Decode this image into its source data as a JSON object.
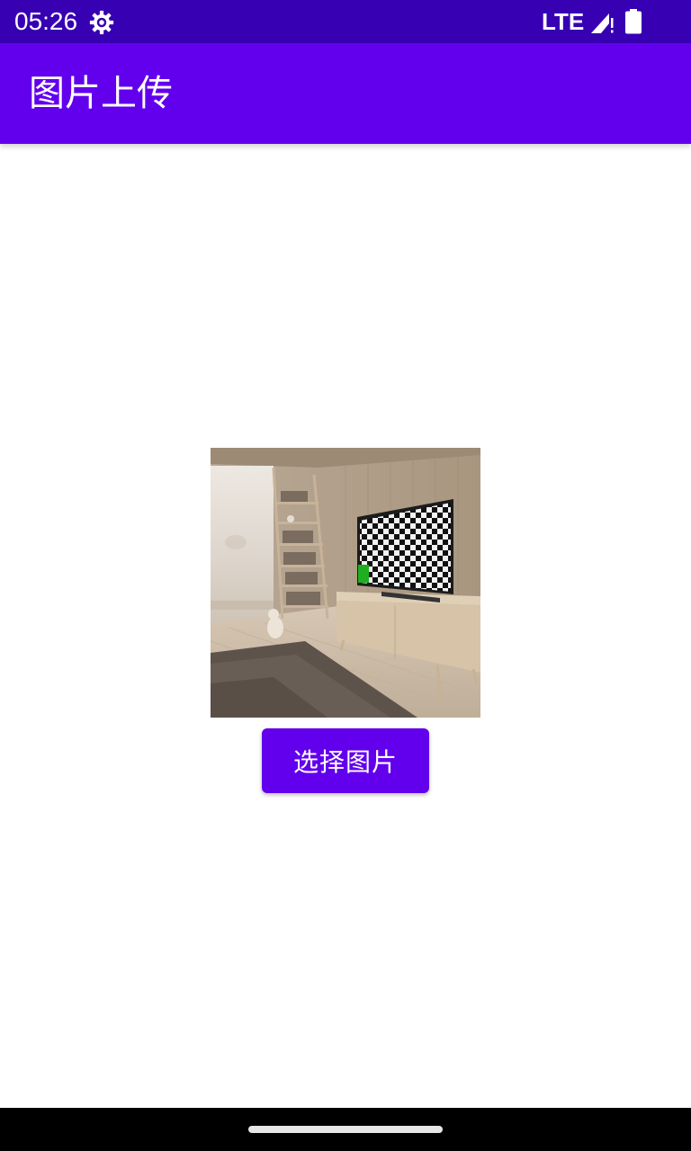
{
  "status_bar": {
    "time": "05:26",
    "network": "LTE",
    "icons": [
      "settings-gear-icon",
      "cell-signal-icon",
      "battery-icon"
    ],
    "background": "#3700b3"
  },
  "app_bar": {
    "title": "图片上传",
    "background": "#6200ee"
  },
  "main": {
    "preview_image": "room-with-tv-checkerboard-screen",
    "select_button_label": "选择图片",
    "button_color": "#6200ee"
  },
  "nav_bar": {
    "handle": "home-gesture-handle"
  }
}
